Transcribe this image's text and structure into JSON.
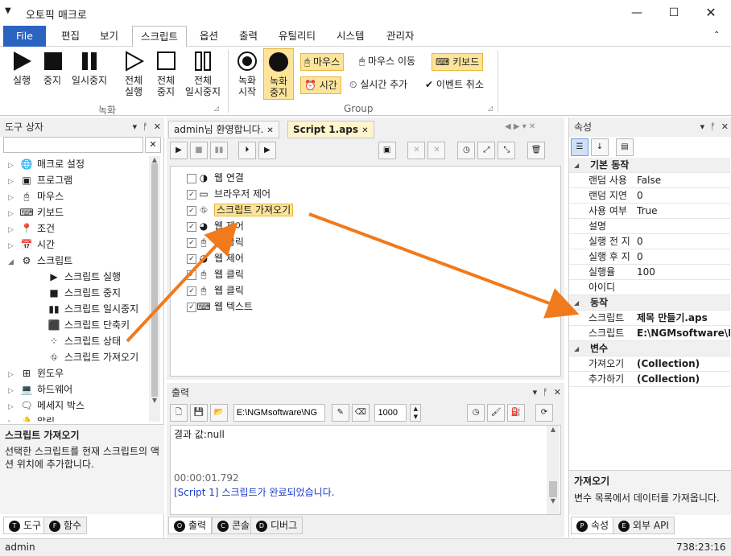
{
  "app": {
    "title": "오토픽 매크로",
    "status_user": "admin",
    "status_coords": "738:23:16"
  },
  "menu": {
    "file": "File",
    "tabs": [
      "편집",
      "보기",
      "스크립트",
      "옵션",
      "출력",
      "유틸리티",
      "시스템",
      "관리자"
    ]
  },
  "ribbon": {
    "run": "실행",
    "stop": "중지",
    "pause": "일시중지",
    "all_run": [
      "전체",
      "실행"
    ],
    "all_stop": [
      "전체",
      "중지"
    ],
    "all_pause": [
      "전체",
      "일시중지"
    ],
    "group1": "녹화",
    "rec_start": [
      "녹화",
      "시작"
    ],
    "rec_stop": [
      "녹화",
      "중지"
    ],
    "mouse": "마우스",
    "mouse_move": "마우스 이동",
    "keyboard": "키보드",
    "time": "시간",
    "realtime_add": "실시간 추가",
    "event_cancel": "이벤트 취소",
    "group2": "Group"
  },
  "toolbox": {
    "title": "도구 상자",
    "items": [
      {
        "label": "매크로 설정",
        "lvl": 0,
        "exp": "▷",
        "icon": "🌐"
      },
      {
        "label": "프로그램",
        "lvl": 0,
        "exp": "▷",
        "icon": "▣"
      },
      {
        "label": "마우스",
        "lvl": 0,
        "exp": "▷",
        "icon": "🖰"
      },
      {
        "label": "키보드",
        "lvl": 0,
        "exp": "▷",
        "icon": "⌨"
      },
      {
        "label": "조건",
        "lvl": 0,
        "exp": "▷",
        "icon": "📍"
      },
      {
        "label": "시간",
        "lvl": 0,
        "exp": "▷",
        "icon": "📅"
      },
      {
        "label": "스크립트",
        "lvl": 0,
        "exp": "◢",
        "icon": "⚙"
      },
      {
        "label": "스크립트 실행",
        "lvl": 1,
        "exp": "",
        "icon": "▶"
      },
      {
        "label": "스크립트 중지",
        "lvl": 1,
        "exp": "",
        "icon": "■"
      },
      {
        "label": "스크립트 일시중지",
        "lvl": 1,
        "exp": "",
        "icon": "▮▮"
      },
      {
        "label": "스크립트 단축키",
        "lvl": 1,
        "exp": "",
        "icon": "⬛"
      },
      {
        "label": "스크립트 상태",
        "lvl": 1,
        "exp": "",
        "icon": "⁘"
      },
      {
        "label": "스크립트 가져오기",
        "lvl": 1,
        "exp": "",
        "icon": "⛗"
      },
      {
        "label": "윈도우",
        "lvl": 0,
        "exp": "▷",
        "icon": "⊞"
      },
      {
        "label": "하드웨어",
        "lvl": 0,
        "exp": "▷",
        "icon": "💻"
      },
      {
        "label": "메세지 박스",
        "lvl": 0,
        "exp": "▷",
        "icon": "🗨"
      },
      {
        "label": "알림",
        "lvl": 0,
        "exp": "▷",
        "icon": "🔔"
      }
    ],
    "desc_title": "스크립트 가져오기",
    "desc_text": "선택한 스크립트를 현재 스크립트의 액션 위치에 추가합니다.",
    "tab_tools": "도구",
    "tab_funcs": "함수",
    "tab_tools_key": "T",
    "tab_funcs_key": "F"
  },
  "doc": {
    "tab1": "admin님 환영합니다.",
    "tab2": "Script 1.aps",
    "actions": [
      {
        "label": "웹 연결",
        "checked": false,
        "icon": "◑"
      },
      {
        "label": "브라우저 제어",
        "checked": true,
        "icon": "▭"
      },
      {
        "label": "스크립트 가져오기",
        "checked": true,
        "icon": "⛗"
      },
      {
        "label": "웹 제어",
        "checked": true,
        "icon": "◕"
      },
      {
        "label": "웹 클릭",
        "checked": true,
        "icon": "🖰"
      },
      {
        "label": "웹 제어",
        "checked": true,
        "icon": "◕"
      },
      {
        "label": "웹 클릭",
        "checked": true,
        "icon": "🖰"
      },
      {
        "label": "웹 클릭",
        "checked": true,
        "icon": "🖰"
      },
      {
        "label": "웹 텍스트",
        "checked": true,
        "icon": "⌨"
      }
    ]
  },
  "output": {
    "title": "출력",
    "path": "E:\\NGMsoftware\\NG",
    "count": "1000",
    "lines": [
      "결과 값:null",
      "",
      "",
      "00:00:01.792",
      "[Script 1] 스크립트가 완료되었습니다."
    ],
    "tab_output": "출력",
    "tab_console": "콘솔",
    "tab_debug": "디버그",
    "tab_output_key": "O",
    "tab_console_key": "C",
    "tab_debug_key": "D"
  },
  "props": {
    "title": "속성",
    "cat1": "기본 동작",
    "rows1": [
      [
        "랜덤 사용",
        "False"
      ],
      [
        "랜덤 지연",
        "0"
      ],
      [
        "사용 여부",
        "True"
      ],
      [
        "설명",
        ""
      ],
      [
        "실행 전 지",
        "0"
      ],
      [
        "실행 후 지",
        "0"
      ],
      [
        "실행율",
        "100"
      ],
      [
        "아이디",
        ""
      ]
    ],
    "cat2": "동작",
    "rows2": [
      [
        "스크립트",
        "제목 만들기.aps"
      ],
      [
        "스크립트",
        "E:\\NGMsoftware\\I"
      ]
    ],
    "cat3": "변수",
    "rows3": [
      [
        "가져오기",
        "(Collection)"
      ],
      [
        "추가하기",
        "(Collection)"
      ]
    ],
    "desc_title": "가져오기",
    "desc_text": "변수 목록에서 데이터를 가져옵니다.",
    "tab_props": "속성",
    "tab_api": "외부 API",
    "tab_props_key": "P",
    "tab_api_key": "E"
  },
  "colors": {
    "accent": "#2b64c0",
    "highlight": "#fce49a",
    "arrow": "#f07a1c",
    "link": "#1a3cc8"
  }
}
